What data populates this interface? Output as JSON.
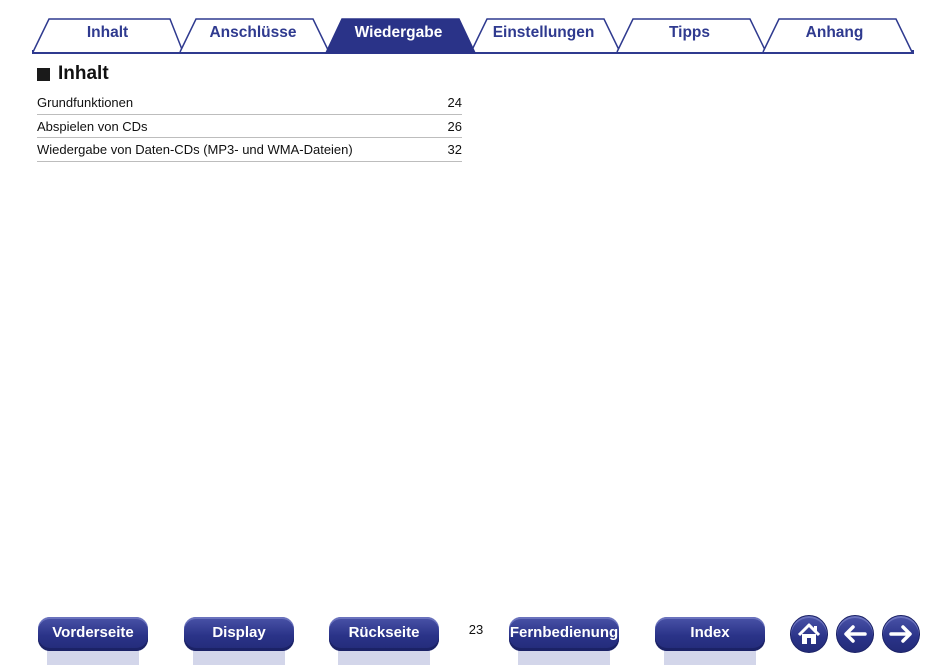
{
  "tabs": [
    {
      "label": "Inhalt",
      "active": false
    },
    {
      "label": "Anschlüsse",
      "active": false
    },
    {
      "label": "Wiedergabe",
      "active": true
    },
    {
      "label": "Einstellungen",
      "active": false
    },
    {
      "label": "Tipps",
      "active": false
    },
    {
      "label": "Anhang",
      "active": false
    }
  ],
  "section": {
    "title": "Inhalt"
  },
  "toc": [
    {
      "label": "Grundfunktionen",
      "page": "24"
    },
    {
      "label": "Abspielen von CDs",
      "page": "26"
    },
    {
      "label": "Wiedergabe von Daten-CDs (MP3- und WMA-Dateien)",
      "page": "32"
    }
  ],
  "nav": {
    "vorderseite": "Vorderseite",
    "display": "Display",
    "rueckseite": "Rückseite",
    "fernbedienung": "Fernbedienung",
    "index": "Index",
    "page_number": "23"
  },
  "icons": {
    "home": "home-icon",
    "back": "arrow-left-icon",
    "forward": "arrow-right-icon"
  },
  "colors": {
    "accent": "#2f3a8f",
    "tab_active_fill": "#2a3388"
  }
}
